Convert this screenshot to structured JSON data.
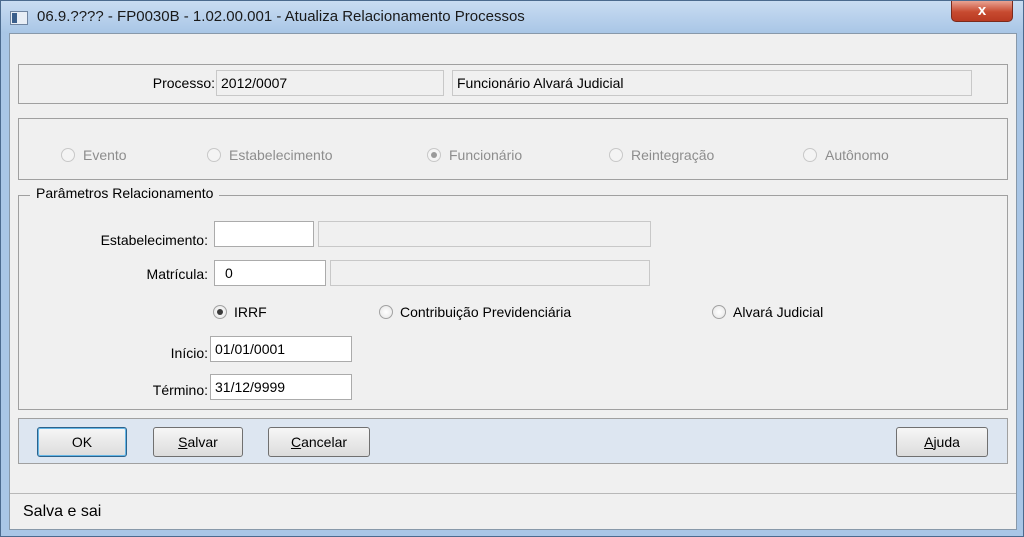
{
  "window": {
    "title": "06.9.???? - FP0030B - 1.02.00.001 - Atualiza Relacionamento Processos",
    "close_label": "x"
  },
  "processo": {
    "label": "Processo:",
    "code": "2012/0007",
    "description": "Funcionário Alvará Judicial"
  },
  "tipo_radios": [
    {
      "label": "Evento",
      "selected": false
    },
    {
      "label": "Estabelecimento",
      "selected": false
    },
    {
      "label": "Funcionário",
      "selected": true
    },
    {
      "label": "Reintegração",
      "selected": false
    },
    {
      "label": "Autônomo",
      "selected": false
    }
  ],
  "parametros": {
    "legend": "Parâmetros Relacionamento",
    "estabelecimento_label": "Estabelecimento:",
    "estabelecimento_value": "",
    "estabelecimento_desc": "",
    "matricula_label": "Matrícula:",
    "matricula_value": "0",
    "matricula_desc": "",
    "options": [
      {
        "label": "IRRF",
        "selected": true
      },
      {
        "label": "Contribuição Previdenciária",
        "selected": false
      },
      {
        "label": "Alvará Judicial",
        "selected": false
      }
    ],
    "inicio_label": "Início:",
    "inicio_value": "01/01/0001",
    "termino_label": "Término:",
    "termino_value": "31/12/9999"
  },
  "buttons": {
    "ok": "OK",
    "salvar_first": "S",
    "salvar_rest": "alvar",
    "cancelar_first": "C",
    "cancelar_rest": "ancelar",
    "ajuda_first": "A",
    "ajuda_rest": "juda"
  },
  "status": {
    "text": "Salva e sai"
  }
}
